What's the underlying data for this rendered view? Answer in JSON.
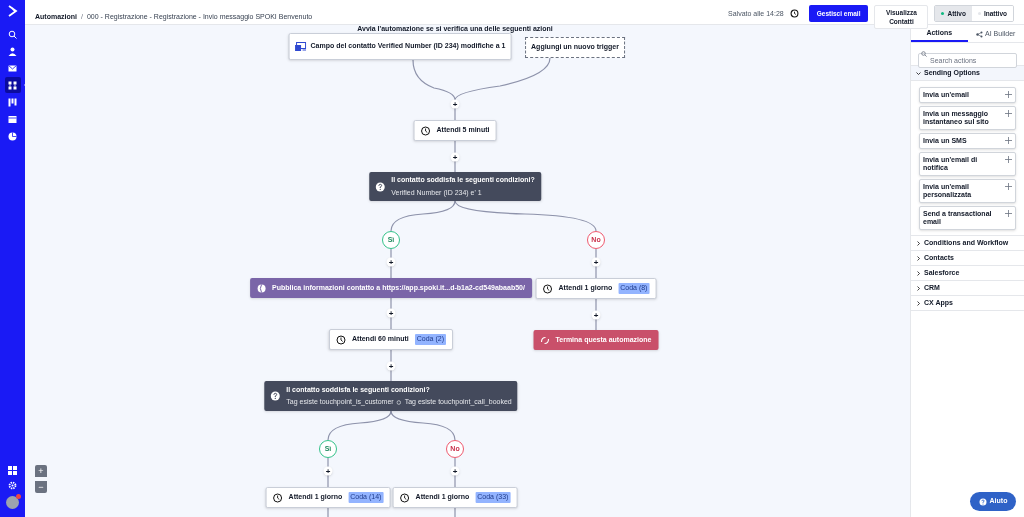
{
  "nav_items": [
    {
      "selected": false
    },
    {
      "selected": false
    },
    {
      "selected": false
    },
    {
      "selected": true
    },
    {
      "selected": false
    },
    {
      "selected": false
    },
    {
      "selected": false
    }
  ],
  "header": {
    "breadcrumb_root": "Automazioni",
    "separator": "/",
    "breadcrumb_current": "000 - Registrazione - Registrazione - Invio messaggio SPOKI Benvenuto",
    "saved": "Salvato alle 14:28",
    "manage_email": "Gestisci email",
    "view_contacts": "Visualizza Contatti",
    "status": [
      {
        "label": "Attivo",
        "selected": true
      },
      {
        "label": "Inattivo",
        "selected": false
      }
    ]
  },
  "canvas": {
    "heading": "Avvia l'automazione se si verifica una delle seguenti azioni",
    "nodes": [
      {
        "kind": "trigger",
        "text": "Campo del contatto Verified Number (ID 234) modifiche a 1"
      },
      {
        "kind": "add_trigger",
        "text": "Aggiungi un nuovo trigger"
      },
      {
        "kind": "add",
        "text": "+"
      },
      {
        "kind": "wait",
        "text": "Attendi 5 minuti"
      },
      {
        "kind": "add",
        "text": "+"
      },
      {
        "kind": "condition",
        "text": "Il contatto soddisfa le seguenti condizioni?",
        "subtitle": "Verified Number (ID 234) e' 1"
      },
      {
        "kind": "yes",
        "text": "Sì"
      },
      {
        "kind": "no",
        "text": "No"
      },
      {
        "kind": "add",
        "text": "+"
      },
      {
        "kind": "add",
        "text": "+"
      },
      {
        "kind": "webhook",
        "text": "Pubblica informazioni contatto a https://app.spoki.it...d-b1a2-cd549abaab50/"
      },
      {
        "kind": "wait",
        "text": "Attendi 1 giorno",
        "queue": "Coda (8)"
      },
      {
        "kind": "add",
        "text": "+"
      },
      {
        "kind": "add",
        "text": "+"
      },
      {
        "kind": "wait",
        "text": "Attendi 60 minuti",
        "queue": "Coda (2)"
      },
      {
        "kind": "end",
        "text": "Termina questa automazione"
      },
      {
        "kind": "add",
        "text": "+"
      },
      {
        "kind": "condition",
        "text": "Il contatto soddisfa le seguenti condizioni?",
        "subtitle": "Tag esiste touchpoint_is_customer",
        "subtitle_2": "Tag esiste touchpoint_call_booked"
      },
      {
        "kind": "yes",
        "text": "Sì"
      },
      {
        "kind": "no",
        "text": "No"
      },
      {
        "kind": "add",
        "text": "+"
      },
      {
        "kind": "add",
        "text": "+"
      },
      {
        "kind": "wait",
        "text": "Attendi 1 giorno",
        "queue": "Coda (14)"
      },
      {
        "kind": "wait",
        "text": "Attendi 1 giorno",
        "queue": "Coda (33)"
      }
    ],
    "zoom_in": "+",
    "zoom_out": "−"
  },
  "panel": {
    "tabs": [
      {
        "label": "Actions",
        "selected": true
      },
      {
        "label": "AI Builder",
        "selected": false
      }
    ],
    "search": {
      "placeholder": "Search actions"
    },
    "groups": [
      {
        "label": "Sending Options",
        "expanded": true,
        "items": [
          "Invia un'email",
          "Invia un messaggio instantaneo sul sito",
          "Invia un SMS",
          "Invia un'email di notifica",
          "Invia un'email personalizzata",
          "Send a transactional email"
        ]
      },
      {
        "label": "Conditions and Workflow",
        "expanded": false
      },
      {
        "label": "Contacts",
        "expanded": false
      },
      {
        "label": "Salesforce",
        "expanded": false
      },
      {
        "label": "CRM",
        "expanded": false
      },
      {
        "label": "CX Apps",
        "expanded": false
      }
    ]
  },
  "help": "Aiuto"
}
